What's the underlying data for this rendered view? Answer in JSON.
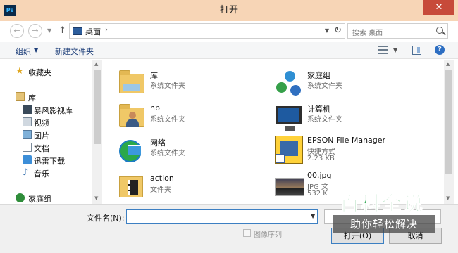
{
  "window": {
    "title": "打开",
    "app_icon_text": "Ps",
    "close_label": "✕"
  },
  "address_bar": {
    "path": "桌面",
    "separator": "›"
  },
  "search": {
    "placeholder": "搜索 桌面"
  },
  "toolbar": {
    "organize_label": "组织",
    "new_folder_label": "新建文件夹",
    "help_label": "?"
  },
  "nav_pane": {
    "items": [
      {
        "label": "收藏夹",
        "icon": "star-icon"
      },
      {
        "label": "库",
        "icon": "library-icon"
      },
      {
        "label": "暴风影视库",
        "icon": "video-library-icon"
      },
      {
        "label": "视频",
        "icon": "video-icon"
      },
      {
        "label": "图片",
        "icon": "pictures-icon"
      },
      {
        "label": "文档",
        "icon": "documents-icon"
      },
      {
        "label": "迅雷下载",
        "icon": "download-icon"
      },
      {
        "label": "音乐",
        "icon": "music-icon"
      },
      {
        "label": "家庭组",
        "icon": "homegroup-icon"
      }
    ]
  },
  "files": [
    {
      "name": "库",
      "sub": "系统文件夹",
      "icon": "library-folder-icon"
    },
    {
      "name": "家庭组",
      "sub": "系统文件夹",
      "icon": "homegroup-icon"
    },
    {
      "name": "hp",
      "sub": "系统文件夹",
      "icon": "user-folder-icon"
    },
    {
      "name": "计算机",
      "sub": "系统文件夹",
      "icon": "computer-icon"
    },
    {
      "name": "网络",
      "sub": "系统文件夹",
      "icon": "network-icon"
    },
    {
      "name": "EPSON File Manager",
      "sub": "快捷方式",
      "sub2": "2.23 KB",
      "icon": "shortcut-icon"
    },
    {
      "name": "action",
      "sub": "文件夹",
      "icon": "folder-icon"
    },
    {
      "name": "00.jpg",
      "sub": "JPG 文",
      "sub2": "532 K",
      "icon": "image-file-icon"
    }
  ],
  "bottom": {
    "filename_label": "文件名(N):",
    "filename_value": "",
    "image_sequence_label": "图像序列",
    "open_label": "打开(O)",
    "cancel_label": "取消"
  },
  "watermark": {
    "line1": "百科全说",
    "line2": "助你轻松解决"
  }
}
